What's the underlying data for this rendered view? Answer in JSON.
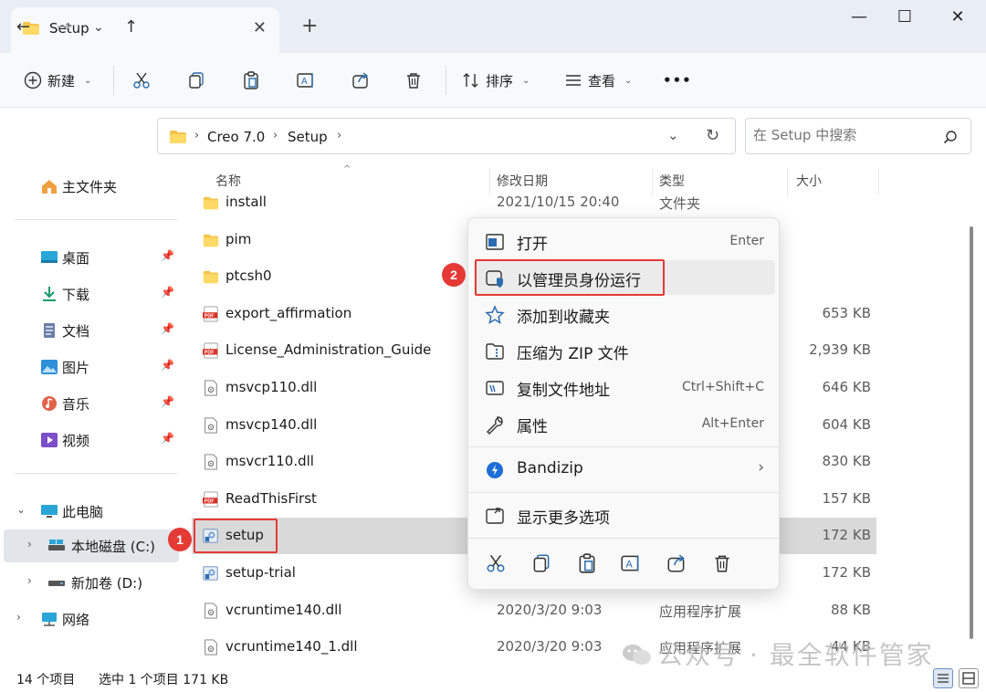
{
  "window": {
    "tab_title": "Setup",
    "tab_close": "✕",
    "new_tab": "+",
    "minimize": "—",
    "maximize": "☐",
    "close": "✕"
  },
  "toolbar": {
    "new_label": "新建",
    "sort_label": "排序",
    "view_label": "查看",
    "more_label": "•••"
  },
  "address": {
    "crumbs": [
      "Creo 7.0",
      "Setup"
    ],
    "search_placeholder": "在 Setup 中搜索"
  },
  "sidebar": {
    "home": "主文件夹",
    "pinned": [
      {
        "label": "桌面",
        "icon": "desktop-icon"
      },
      {
        "label": "下载",
        "icon": "download-icon"
      },
      {
        "label": "文档",
        "icon": "document-icon"
      },
      {
        "label": "图片",
        "icon": "picture-icon"
      },
      {
        "label": "音乐",
        "icon": "music-icon"
      },
      {
        "label": "视频",
        "icon": "video-icon"
      }
    ],
    "this_pc": "此电脑",
    "drive_c": "本地磁盘 (C:)",
    "drive_d": "新加卷 (D:)",
    "network": "网络"
  },
  "columns": {
    "name": "名称",
    "modified": "修改日期",
    "type": "类型",
    "size": "大小"
  },
  "files": [
    {
      "name": "install",
      "date": "2021/10/15 20:40",
      "type": "文件夹",
      "size": "",
      "kind": "folder"
    },
    {
      "name": "pim",
      "date": "",
      "type": "",
      "size": "",
      "kind": "folder"
    },
    {
      "name": "ptcsh0",
      "date": "",
      "type": "",
      "size": "",
      "kind": "folder"
    },
    {
      "name": "export_affirmation",
      "date": "",
      "type": "",
      "size": "653 KB",
      "kind": "pdf"
    },
    {
      "name": "License_Administration_Guide",
      "date": "",
      "type": "",
      "size": "2,939 KB",
      "kind": "pdf"
    },
    {
      "name": "msvcp110.dll",
      "date": "",
      "type": "",
      "size": "646 KB",
      "kind": "dll"
    },
    {
      "name": "msvcp140.dll",
      "date": "",
      "type": "",
      "size": "604 KB",
      "kind": "dll"
    },
    {
      "name": "msvcr110.dll",
      "date": "",
      "type": "",
      "size": "830 KB",
      "kind": "dll"
    },
    {
      "name": "ReadThisFirst",
      "date": "",
      "type": "",
      "size": "157 KB",
      "kind": "pdf"
    },
    {
      "name": "setup",
      "date": "",
      "type": "",
      "size": "172 KB",
      "kind": "exe"
    },
    {
      "name": "setup-trial",
      "date": "",
      "type": "",
      "size": "172 KB",
      "kind": "exe"
    },
    {
      "name": "vcruntime140.dll",
      "date": "2020/3/20 9:03",
      "type": "应用程序扩展",
      "size": "88 KB",
      "kind": "dll"
    },
    {
      "name": "vcruntime140_1.dll",
      "date": "2020/3/20 9:03",
      "type": "应用程序扩展",
      "size": "44 KB",
      "kind": "dll"
    }
  ],
  "context_menu": {
    "open": {
      "label": "打开",
      "shortcut": "Enter"
    },
    "run_as_admin": {
      "label": "以管理员身份运行"
    },
    "add_favorites": {
      "label": "添加到收藏夹"
    },
    "compress_zip": {
      "label": "压缩为 ZIP 文件"
    },
    "copy_path": {
      "label": "复制文件地址",
      "shortcut": "Ctrl+Shift+C"
    },
    "properties": {
      "label": "属性",
      "shortcut": "Alt+Enter"
    },
    "bandizip": {
      "label": "Bandizip"
    },
    "more_options": {
      "label": "显示更多选项"
    }
  },
  "annotations": {
    "badge1": "1",
    "badge2": "2",
    "accent": "#e53935"
  },
  "status": {
    "count": "14 个项目",
    "selected": "选中 1 个项目  171 KB"
  },
  "watermark": "公众号 · 最全软件管家"
}
